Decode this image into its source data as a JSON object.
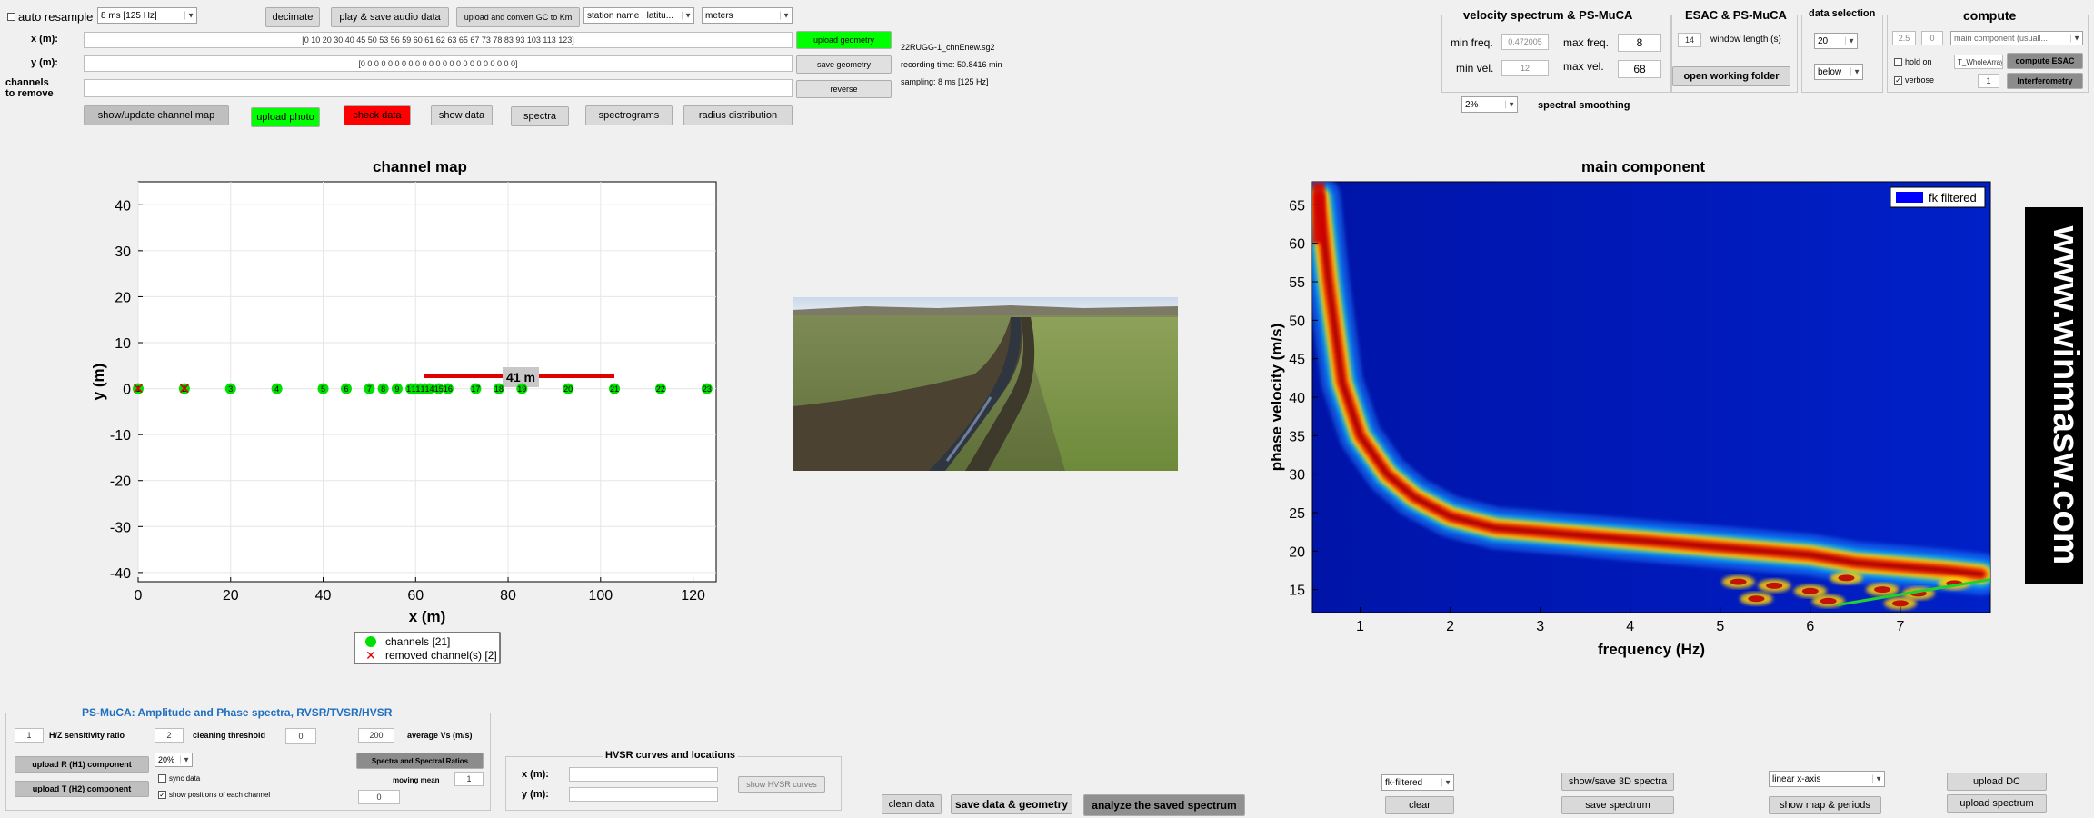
{
  "top": {
    "auto_resample": "auto resample",
    "sampling_select": "8 ms [125 Hz]",
    "decimate": "decimate",
    "play_save_audio": "play & save audio data",
    "upload_convert_gc": "upload and convert GC to Km",
    "station_select": "station name , latitu...",
    "units_select": "meters",
    "x_label": "x (m):",
    "y_label": "y (m):",
    "channels_remove_label_1": "channels",
    "channels_remove_label_2": "to remove",
    "x_value": "[0  10  20  30  40  45  50  53  56  59  60  61  62  63  65  67  73  78  83  93  103  113  123]",
    "y_value": "[0  0  0  0  0  0  0  0  0  0  0  0  0  0  0  0  0  0  0  0  0  0  0]",
    "channels_remove_value": "",
    "upload_geometry": "upload geometry",
    "save_geometry": "save geometry",
    "reverse": "reverse",
    "file_name": "22RUGG-1_chnEnew.sg2",
    "recording_time": "recording time: 50.8416 min",
    "sampling": "sampling: 8 ms [125 Hz]",
    "show_update_map": "show/update channel map",
    "upload_photo": "upload photo",
    "check_data": "check data",
    "show_data": "show data",
    "spectra": "spectra",
    "spectrograms": "spectrograms",
    "radius_distribution": "radius distribution"
  },
  "velocity_panel": {
    "title": "velocity spectrum & PS-MuCA",
    "min_freq_label": "min freq.",
    "min_freq": "0.472005",
    "max_freq_label": "max freq.",
    "max_freq": "8",
    "min_vel_label": "min vel.",
    "min_vel": "12",
    "max_vel_label": "max vel.",
    "max_vel": "68",
    "smoothing_select": "2%",
    "smoothing_label": "spectral smoothing"
  },
  "esac_panel": {
    "title": "ESAC & PS-MuCA",
    "window_value": "14",
    "window_label": "window length (s)",
    "open_folder": "open working folder"
  },
  "data_selection": {
    "title": "data selection",
    "value_select": "20",
    "mode_select": "below"
  },
  "compute_panel": {
    "title": "compute",
    "f1": "2.5",
    "f2": "0",
    "component_select": "main component (usuall...",
    "hold_on": "hold on",
    "array_name": "T_WholeArray",
    "compute_esac": "compute ESAC",
    "verbose": "verbose",
    "verbose_value": "1",
    "interferometry": "Interferometry"
  },
  "channel_map": {
    "title": "channel map",
    "xlabel": "x (m)",
    "ylabel": "y (m)",
    "x_ticks": [
      "0",
      "20",
      "40",
      "60",
      "80",
      "100",
      "120"
    ],
    "y_ticks": [
      "40",
      "30",
      "20",
      "10",
      "0",
      "-10",
      "-20",
      "-30",
      "-40"
    ],
    "distance_label": "41 m",
    "legend_channels": "channels [21]",
    "legend_removed": "removed channel(s) [2]",
    "channels": [
      {
        "id": "1",
        "x": 0,
        "removed": true
      },
      {
        "id": "2",
        "x": 10,
        "removed": true
      },
      {
        "id": "3",
        "x": 20,
        "removed": false
      },
      {
        "id": "4",
        "x": 30,
        "removed": false
      },
      {
        "id": "5",
        "x": 40,
        "removed": false
      },
      {
        "id": "6",
        "x": 45,
        "removed": false
      },
      {
        "id": "7",
        "x": 50,
        "removed": false
      },
      {
        "id": "8",
        "x": 53,
        "removed": false
      },
      {
        "id": "9",
        "x": 56,
        "removed": false
      },
      {
        "id": "10",
        "x": 59,
        "removed": false
      },
      {
        "id": "11",
        "x": 60,
        "removed": false
      },
      {
        "id": "12",
        "x": 61,
        "removed": false
      },
      {
        "id": "13",
        "x": 62,
        "removed": false
      },
      {
        "id": "14",
        "x": 63,
        "removed": false
      },
      {
        "id": "15",
        "x": 65,
        "removed": false
      },
      {
        "id": "16",
        "x": 67,
        "removed": false
      },
      {
        "id": "17",
        "x": 73,
        "removed": false
      },
      {
        "id": "18",
        "x": 78,
        "removed": false
      },
      {
        "id": "19",
        "x": 83,
        "removed": false
      },
      {
        "id": "20",
        "x": 93,
        "removed": false
      },
      {
        "id": "21",
        "x": 103,
        "removed": false
      },
      {
        "id": "22",
        "x": 113,
        "removed": false
      },
      {
        "id": "23",
        "x": 123,
        "removed": false
      }
    ]
  },
  "main_component": {
    "title": "main component",
    "xlabel": "frequency (Hz)",
    "ylabel": "phase velocity (m/s)",
    "x_ticks": [
      "1",
      "2",
      "3",
      "4",
      "5",
      "6",
      "7"
    ],
    "y_ticks": [
      "65",
      "60",
      "55",
      "50",
      "45",
      "40",
      "35",
      "30",
      "25",
      "20",
      "15"
    ],
    "legend": "fk filtered",
    "legend_color": "#0000ff"
  },
  "watermark": "www.winmasw.com",
  "psmuca": {
    "title": "PS-MuCA: Amplitude and Phase spectra, RVSR/TVSR/HVSR",
    "hz_value": "1",
    "hz_label": "H/Z sensitivity ratio",
    "clean_value": "2",
    "clean_label": "cleaning threshold",
    "clean_value2": "0",
    "avg_vs_value": "200",
    "avg_vs_label": "average Vs (m/s)",
    "upload_r": "upload R (H1) component",
    "upload_t": "upload T (H2) component",
    "pct_select": "20%",
    "spectra_ratios": "Spectra and Spectral Ratios",
    "sync_data": "sync data",
    "moving_mean_label": "moving mean",
    "moving_mean_value": "1",
    "show_positions": "show positions of each channel",
    "bottom_value": "0"
  },
  "hvsr": {
    "title": "HVSR curves and locations",
    "x_label": "x (m):",
    "y_label": "y (m):",
    "show_curves": "show HVSR curves"
  },
  "bottom": {
    "clean_data": "clean data",
    "save_data_geometry": "save data & geometry",
    "analyze_saved": "analyze the saved spectrum",
    "fk_select": "fk-filtered",
    "clear": "clear",
    "show_save_3d": "show/save 3D spectra",
    "save_spectrum": "save spectrum",
    "axis_select": "linear x-axis",
    "show_map_periods": "show map & periods",
    "upload_dc": "upload DC",
    "upload_spectrum": "upload spectrum"
  },
  "chart_data": [
    {
      "type": "scatter",
      "title": "channel map",
      "xlabel": "x (m)",
      "ylabel": "y (m)",
      "xlim": [
        0,
        125
      ],
      "ylim": [
        -42,
        45
      ],
      "series": [
        {
          "name": "channels [21]",
          "x": [
            20,
            30,
            40,
            45,
            50,
            53,
            56,
            59,
            60,
            61,
            62,
            63,
            65,
            67,
            73,
            78,
            83,
            93,
            103,
            113,
            123
          ],
          "y": [
            0,
            0,
            0,
            0,
            0,
            0,
            0,
            0,
            0,
            0,
            0,
            0,
            0,
            0,
            0,
            0,
            0,
            0,
            0,
            0,
            0
          ]
        },
        {
          "name": "removed channel(s) [2]",
          "x": [
            0,
            10
          ],
          "y": [
            0,
            0
          ]
        }
      ]
    },
    {
      "type": "heatmap",
      "title": "main component",
      "xlabel": "frequency (Hz)",
      "ylabel": "phase velocity (m/s)",
      "xlim": [
        0.47,
        8
      ],
      "ylim": [
        12,
        68
      ],
      "series": [
        {
          "name": "fk filtered",
          "x": [
            0.55,
            0.65,
            0.8,
            1.0,
            1.3,
            1.6,
            2.0,
            2.5,
            3.0,
            3.5,
            4.0,
            4.5,
            5.0,
            5.5,
            6.0,
            6.5,
            7.0,
            7.5,
            7.9
          ],
          "y": [
            66,
            55,
            42,
            35,
            30,
            27,
            24.5,
            23,
            22.5,
            22,
            21.5,
            21,
            20.5,
            20,
            19.5,
            18.5,
            18,
            17.5,
            17
          ]
        }
      ]
    }
  ]
}
